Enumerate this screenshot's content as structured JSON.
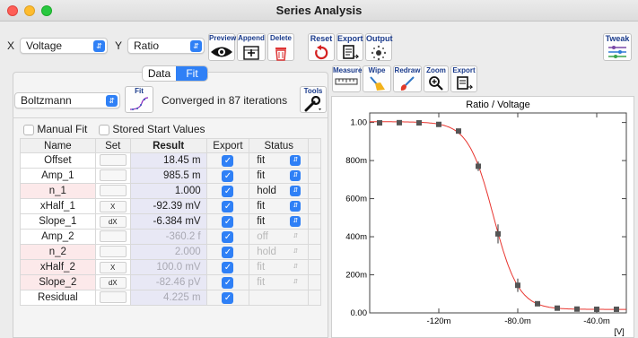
{
  "window": {
    "title": "Series Analysis"
  },
  "toolbar": {
    "x_label": "X",
    "x_value": "Voltage",
    "y_label": "Y",
    "y_value": "Ratio",
    "preview": "Preview",
    "append": "Append",
    "delete": "Delete",
    "reset": "Reset",
    "export": "Export",
    "output": "Output",
    "tweak": "Tweak"
  },
  "tabs": {
    "data": "Data",
    "fit": "Fit",
    "selected": "Fit"
  },
  "fit": {
    "function": "Boltzmann",
    "fit_button": "Fit",
    "status": "Converged in 87 iterations",
    "tools": "Tools",
    "manual_fit": "Manual Fit",
    "stored_start": "Stored Start Values"
  },
  "table": {
    "headers": [
      "Name",
      "Set",
      "Result",
      "Export",
      "Status"
    ],
    "rows": [
      {
        "name": "Offset",
        "set": "",
        "result": "18.45 m",
        "export": true,
        "status": "fit",
        "dim": false,
        "pink": false
      },
      {
        "name": "Amp_1",
        "set": "",
        "result": "985.5 m",
        "export": true,
        "status": "fit",
        "dim": false,
        "pink": false
      },
      {
        "name": "n_1",
        "set": "",
        "result": "1.000",
        "export": true,
        "status": "hold",
        "dim": false,
        "pink": true
      },
      {
        "name": "xHalf_1",
        "set": "X",
        "result": "-92.39 mV",
        "export": true,
        "status": "fit",
        "dim": false,
        "pink": false
      },
      {
        "name": "Slope_1",
        "set": "dX",
        "result": "-6.384 mV",
        "export": true,
        "status": "fit",
        "dim": false,
        "pink": false
      },
      {
        "name": "Amp_2",
        "set": "",
        "result": "-360.2 f",
        "export": true,
        "status": "off",
        "dim": true,
        "pink": false
      },
      {
        "name": "n_2",
        "set": "",
        "result": "2.000",
        "export": true,
        "status": "hold",
        "dim": true,
        "pink": true
      },
      {
        "name": "xHalf_2",
        "set": "X",
        "result": "100.0 mV",
        "export": true,
        "status": "fit",
        "dim": true,
        "pink": true
      },
      {
        "name": "Slope_2",
        "set": "dX",
        "result": "-82.46 pV",
        "export": true,
        "status": "fit",
        "dim": true,
        "pink": true
      },
      {
        "name": "Residual",
        "set": "",
        "result": "4.225 m",
        "export": true,
        "status": "",
        "dim": true,
        "pink": false
      }
    ]
  },
  "plot_toolbar": {
    "measure": "Measure",
    "wipe": "Wipe",
    "redraw": "Redraw",
    "zoom": "Zoom",
    "export": "Export"
  },
  "chart_data": {
    "type": "scatter",
    "title": "Ratio / Voltage",
    "xunit": "[V]",
    "xlim": [
      -0.155,
      -0.025
    ],
    "ylim": [
      0.0,
      1.05
    ],
    "xticks": [
      {
        "v": -0.12,
        "label": "-120m"
      },
      {
        "v": -0.08,
        "label": "-80.0m"
      },
      {
        "v": -0.04,
        "label": "-40.0m"
      }
    ],
    "yticks": [
      {
        "v": 0.0,
        "label": "0.00"
      },
      {
        "v": 0.2,
        "label": "200m"
      },
      {
        "v": 0.4,
        "label": "400m"
      },
      {
        "v": 0.6,
        "label": "600m"
      },
      {
        "v": 0.8,
        "label": "800m"
      },
      {
        "v": 1.0,
        "label": "1.00"
      }
    ],
    "points": [
      {
        "x": -0.15,
        "y": 0.998,
        "err": 0.0
      },
      {
        "x": -0.14,
        "y": 0.999,
        "err": 0.0
      },
      {
        "x": -0.13,
        "y": 0.998,
        "err": 0.0
      },
      {
        "x": -0.12,
        "y": 0.99,
        "err": 0.0
      },
      {
        "x": -0.11,
        "y": 0.955,
        "err": 0.01
      },
      {
        "x": -0.1,
        "y": 0.77,
        "err": 0.025
      },
      {
        "x": -0.09,
        "y": 0.415,
        "err": 0.05
      },
      {
        "x": -0.08,
        "y": 0.145,
        "err": 0.035
      },
      {
        "x": -0.07,
        "y": 0.048,
        "err": 0.0
      },
      {
        "x": -0.06,
        "y": 0.025,
        "err": 0.0
      },
      {
        "x": -0.05,
        "y": 0.02,
        "err": 0.0
      },
      {
        "x": -0.04,
        "y": 0.019,
        "err": 0.0
      },
      {
        "x": -0.03,
        "y": 0.019,
        "err": 0.0
      }
    ],
    "fit": {
      "offset": 0.01845,
      "amp": 0.9855,
      "xhalf": -0.09239,
      "slope": -0.006384
    },
    "colors": {
      "marker": "#555555",
      "curve": "#e8352f"
    }
  }
}
